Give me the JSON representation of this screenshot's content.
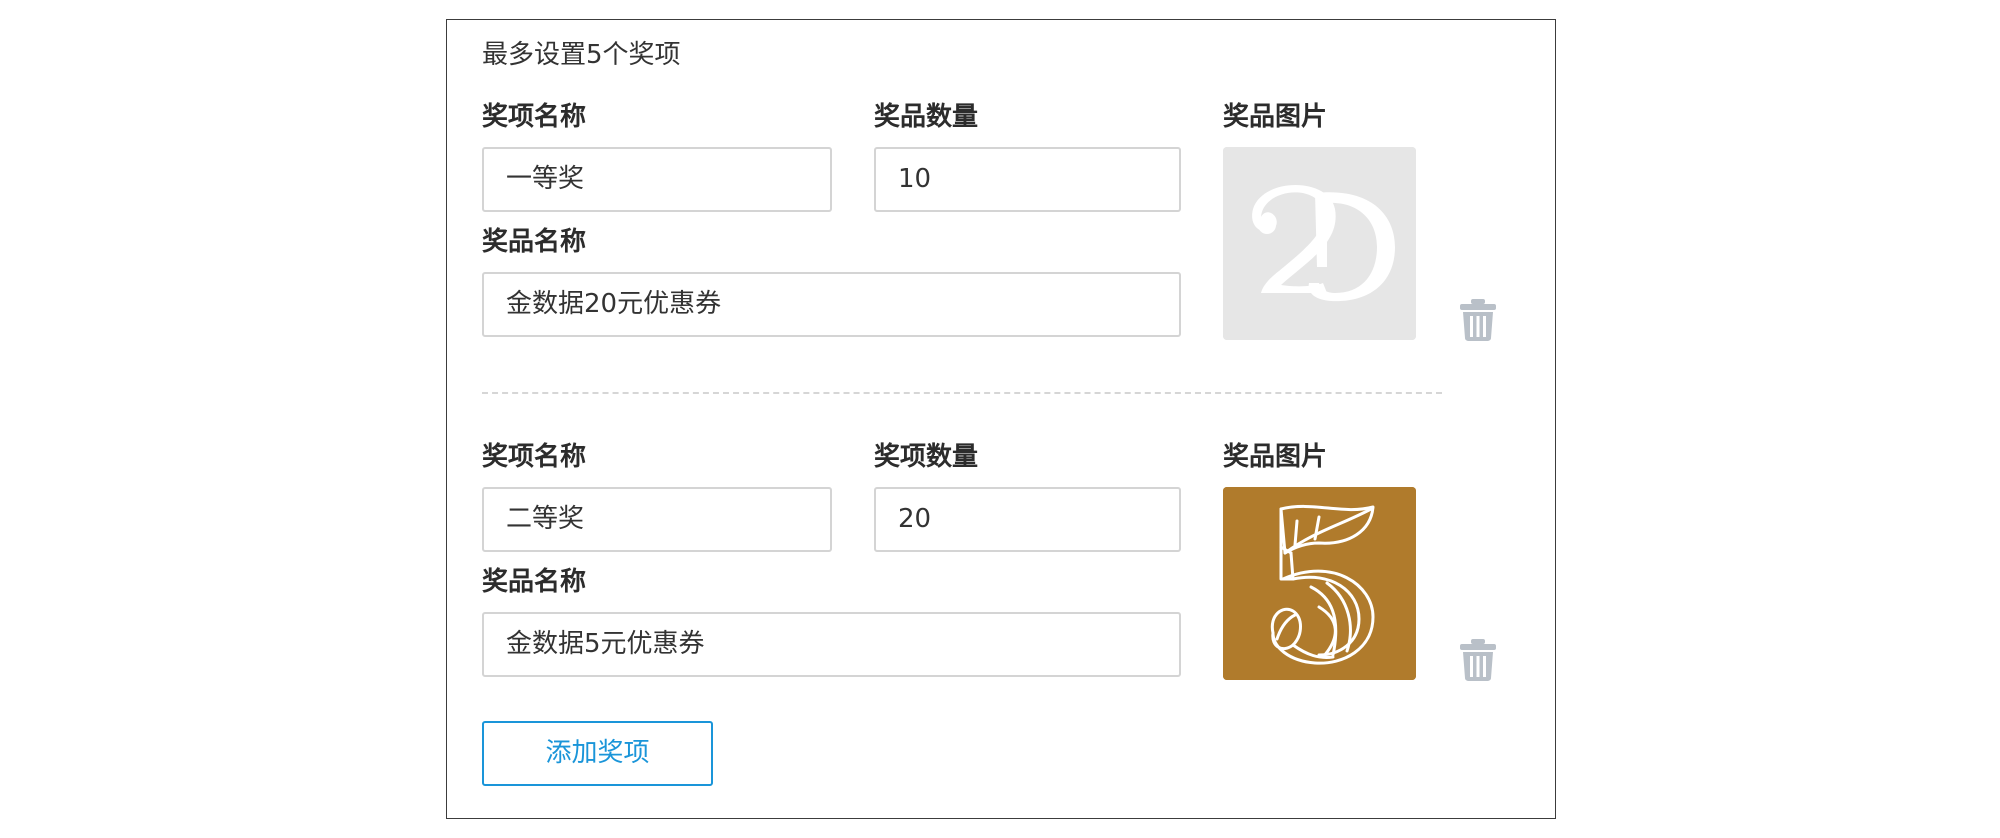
{
  "form": {
    "hint": "最多设置5个奖项",
    "add_button_label": "添加奖项"
  },
  "prizes": [
    {
      "award_name_label": "奖项名称",
      "award_name_value": "一等奖",
      "quantity_label": "奖品数量",
      "quantity_value": "10",
      "image_label": "奖品图片",
      "prize_name_label": "奖品名称",
      "prize_name_value": "金数据20元优惠券",
      "image_icon": "number-20-graphic",
      "image_bg": "#e6e6e6"
    },
    {
      "award_name_label": "奖项名称",
      "award_name_value": "二等奖",
      "quantity_label": "奖项数量",
      "quantity_value": "20",
      "image_label": "奖品图片",
      "prize_name_label": "奖品名称",
      "prize_name_value": "金数据5元优惠券",
      "image_icon": "number-5-graphic",
      "image_bg": "#b07b2c"
    }
  ],
  "colors": {
    "accent": "#1a95d9",
    "trash_icon": "#b9c0c8",
    "border": "#d4d4d4"
  }
}
